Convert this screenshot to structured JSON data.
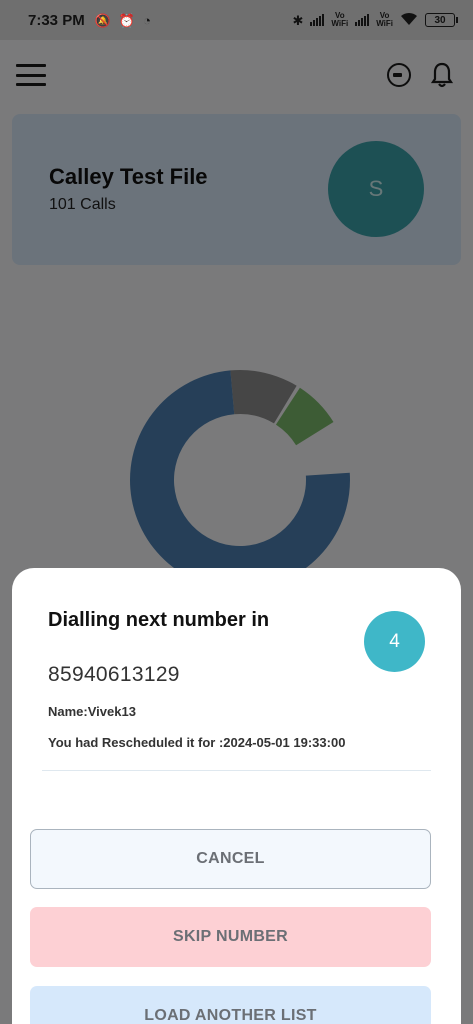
{
  "status_bar": {
    "time": "7:33 PM",
    "left_icons": [
      "mute-icon",
      "alarm-icon",
      "app-icon"
    ],
    "vo_wifi_1": "Vo\nWiFi",
    "vo_wifi_2": "Vo\nWiFi",
    "battery": "30"
  },
  "header": {
    "menu_icon": "hamburger-menu-icon",
    "sync_icon": "sync-icon",
    "notification_icon": "bell-icon"
  },
  "file_card": {
    "title": "Calley Test File",
    "subtitle": "101 Calls",
    "avatar_letter": "S"
  },
  "chart_data": {
    "type": "pie",
    "series": [
      {
        "value": 76,
        "color": "#4c7fb0"
      },
      {
        "value": 10,
        "color": "#8c8c8c"
      },
      {
        "value": 7,
        "color": "#7ab86a"
      }
    ]
  },
  "dialog": {
    "title": "Dialling next number in",
    "number": "85940613129",
    "countdown": "4",
    "name": "Name:Vivek13",
    "rescheduled": "You had Rescheduled it for :2024-05-01 19:33:00",
    "cancel_label": "CANCEL",
    "skip_label": "SKIP NUMBER",
    "load_label": "LOAD ANOTHER LIST"
  },
  "colors": {
    "avatar": "#3aa0a8",
    "countdown": "#3fb7c8",
    "skip_button": "#fdd0d4",
    "load_button": "#d6e8fb",
    "card": "#d7e6f7"
  }
}
